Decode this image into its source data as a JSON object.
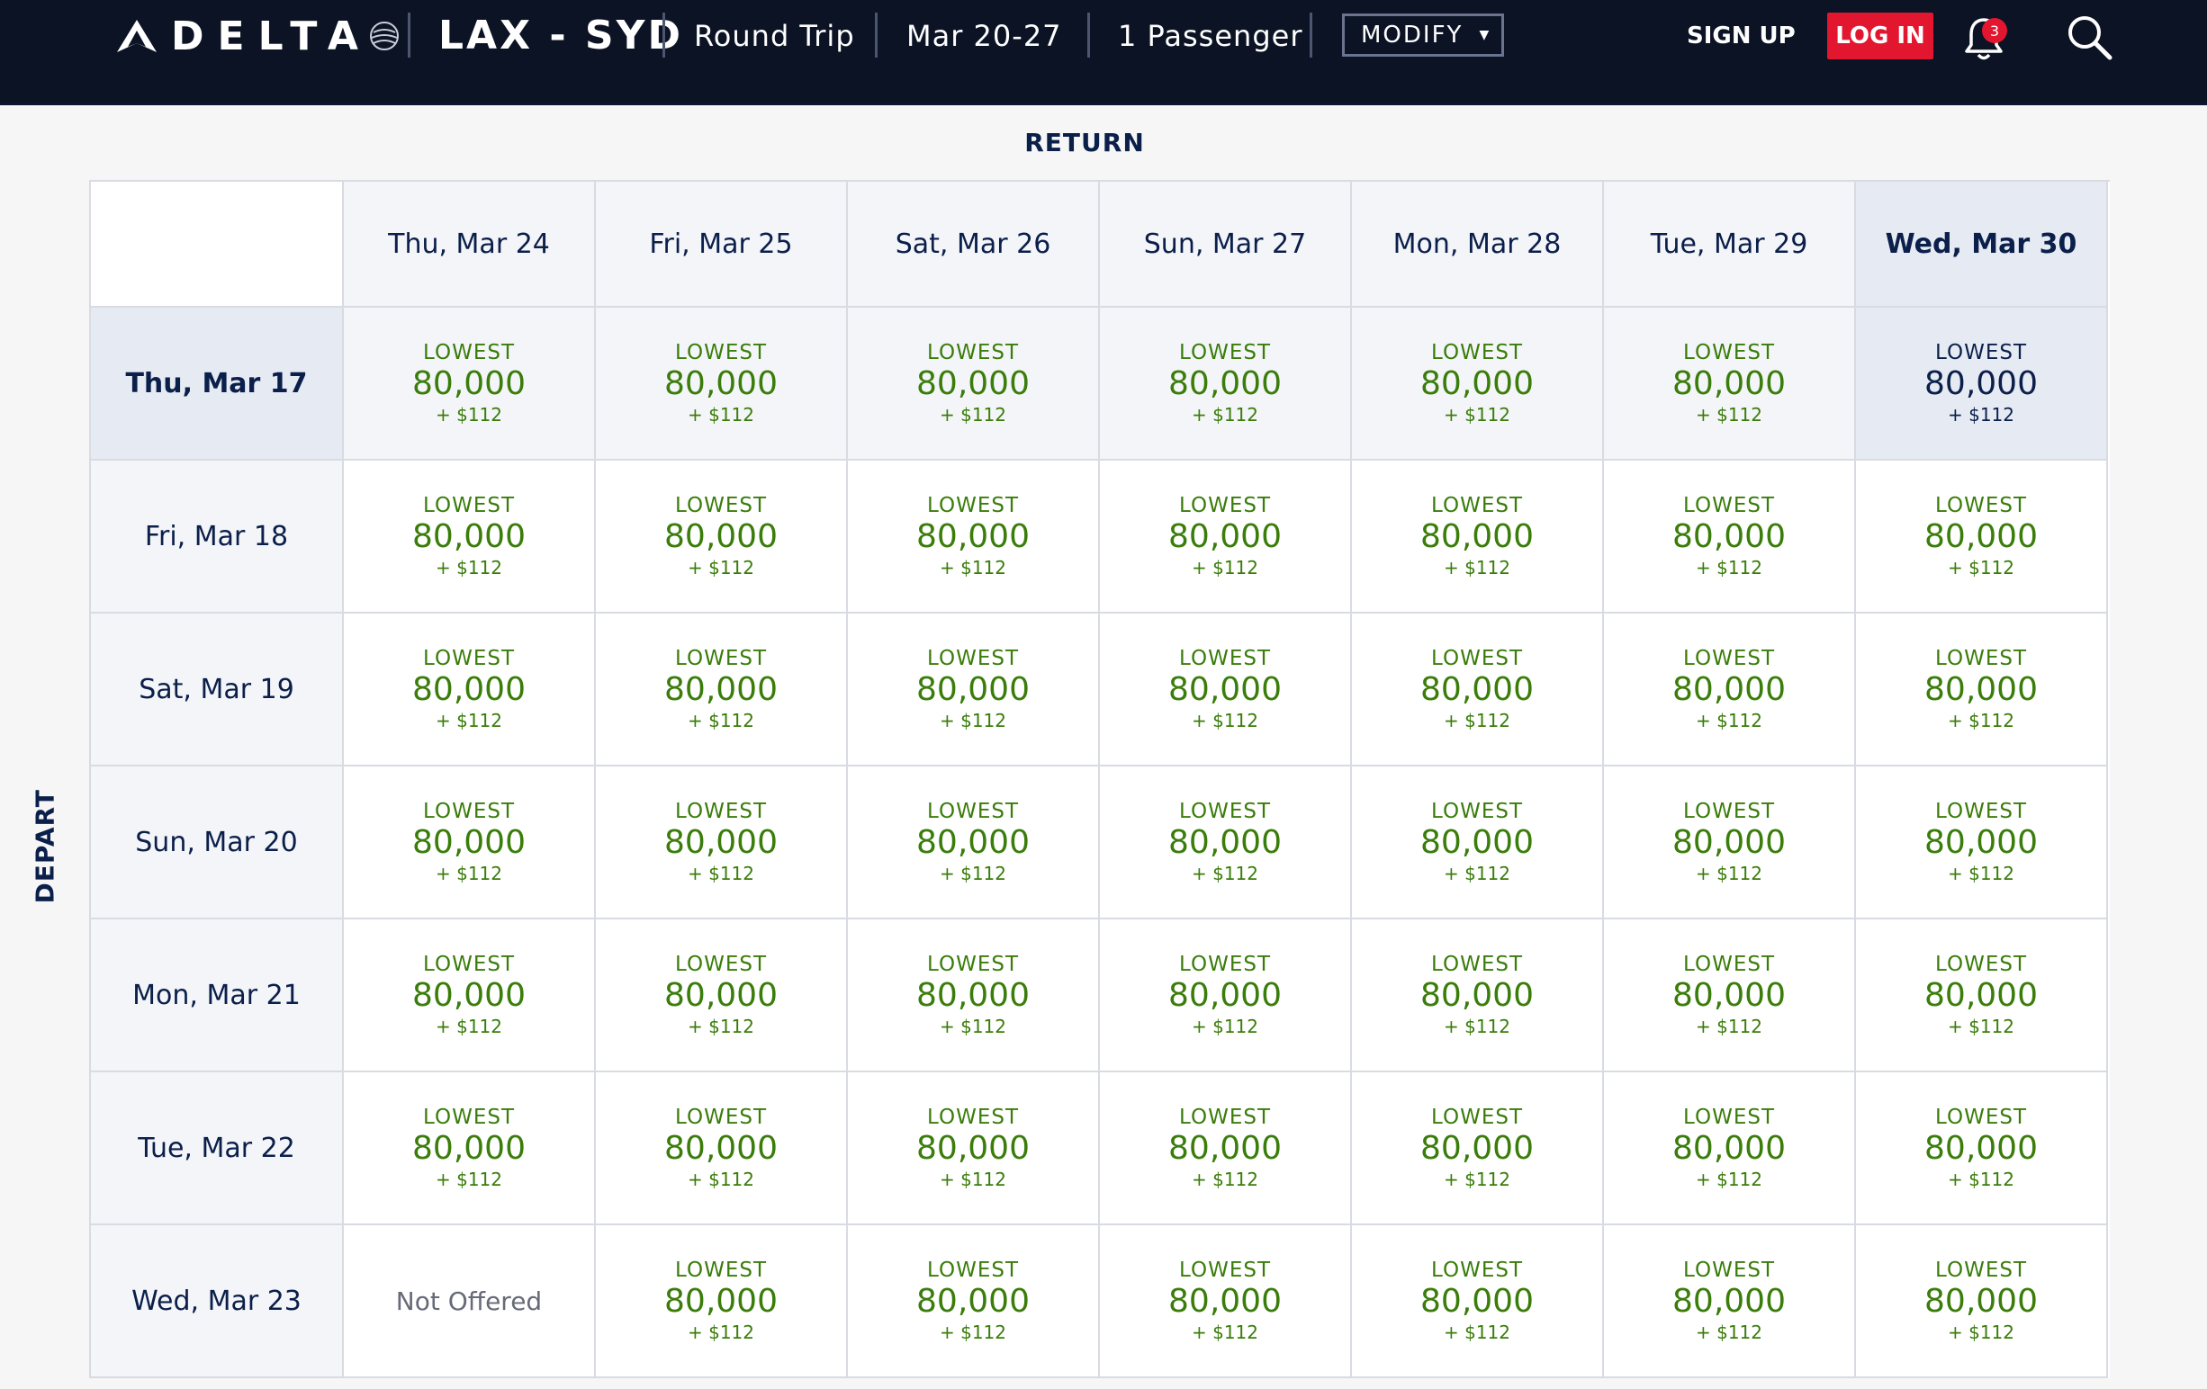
{
  "header": {
    "brand": "DELTA",
    "route": "LAX - SYD",
    "trip_type": "Round Trip",
    "dates": "Mar 20-27",
    "passengers": "1 Passenger",
    "modify_label": "MODIFY",
    "sign_up_label": "SIGN UP",
    "log_in_label": "LOG IN",
    "notification_count": "3"
  },
  "labels": {
    "return": "RETURN",
    "depart": "DEPART"
  },
  "return_dates": [
    "Thu, Mar 24",
    "Fri, Mar 25",
    "Sat, Mar 26",
    "Sun, Mar 27",
    "Mon, Mar 28",
    "Tue, Mar 29",
    "Wed, Mar 30"
  ],
  "selected_return_index": 6,
  "selected_depart_index": 0,
  "rows": [
    {
      "depart": "Thu, Mar 17",
      "fares": [
        {
          "label": "LOWEST",
          "miles": "80,000",
          "tax": "+ $112"
        },
        {
          "label": "LOWEST",
          "miles": "80,000",
          "tax": "+ $112"
        },
        {
          "label": "LOWEST",
          "miles": "80,000",
          "tax": "+ $112"
        },
        {
          "label": "LOWEST",
          "miles": "80,000",
          "tax": "+ $112"
        },
        {
          "label": "LOWEST",
          "miles": "80,000",
          "tax": "+ $112"
        },
        {
          "label": "LOWEST",
          "miles": "80,000",
          "tax": "+ $112"
        },
        {
          "label": "LOWEST",
          "miles": "80,000",
          "tax": "+ $112"
        }
      ]
    },
    {
      "depart": "Fri, Mar 18",
      "fares": [
        {
          "label": "LOWEST",
          "miles": "80,000",
          "tax": "+ $112"
        },
        {
          "label": "LOWEST",
          "miles": "80,000",
          "tax": "+ $112"
        },
        {
          "label": "LOWEST",
          "miles": "80,000",
          "tax": "+ $112"
        },
        {
          "label": "LOWEST",
          "miles": "80,000",
          "tax": "+ $112"
        },
        {
          "label": "LOWEST",
          "miles": "80,000",
          "tax": "+ $112"
        },
        {
          "label": "LOWEST",
          "miles": "80,000",
          "tax": "+ $112"
        },
        {
          "label": "LOWEST",
          "miles": "80,000",
          "tax": "+ $112"
        }
      ]
    },
    {
      "depart": "Sat, Mar 19",
      "fares": [
        {
          "label": "LOWEST",
          "miles": "80,000",
          "tax": "+ $112"
        },
        {
          "label": "LOWEST",
          "miles": "80,000",
          "tax": "+ $112"
        },
        {
          "label": "LOWEST",
          "miles": "80,000",
          "tax": "+ $112"
        },
        {
          "label": "LOWEST",
          "miles": "80,000",
          "tax": "+ $112"
        },
        {
          "label": "LOWEST",
          "miles": "80,000",
          "tax": "+ $112"
        },
        {
          "label": "LOWEST",
          "miles": "80,000",
          "tax": "+ $112"
        },
        {
          "label": "LOWEST",
          "miles": "80,000",
          "tax": "+ $112"
        }
      ]
    },
    {
      "depart": "Sun, Mar 20",
      "fares": [
        {
          "label": "LOWEST",
          "miles": "80,000",
          "tax": "+ $112"
        },
        {
          "label": "LOWEST",
          "miles": "80,000",
          "tax": "+ $112"
        },
        {
          "label": "LOWEST",
          "miles": "80,000",
          "tax": "+ $112"
        },
        {
          "label": "LOWEST",
          "miles": "80,000",
          "tax": "+ $112"
        },
        {
          "label": "LOWEST",
          "miles": "80,000",
          "tax": "+ $112"
        },
        {
          "label": "LOWEST",
          "miles": "80,000",
          "tax": "+ $112"
        },
        {
          "label": "LOWEST",
          "miles": "80,000",
          "tax": "+ $112"
        }
      ]
    },
    {
      "depart": "Mon, Mar 21",
      "fares": [
        {
          "label": "LOWEST",
          "miles": "80,000",
          "tax": "+ $112"
        },
        {
          "label": "LOWEST",
          "miles": "80,000",
          "tax": "+ $112"
        },
        {
          "label": "LOWEST",
          "miles": "80,000",
          "tax": "+ $112"
        },
        {
          "label": "LOWEST",
          "miles": "80,000",
          "tax": "+ $112"
        },
        {
          "label": "LOWEST",
          "miles": "80,000",
          "tax": "+ $112"
        },
        {
          "label": "LOWEST",
          "miles": "80,000",
          "tax": "+ $112"
        },
        {
          "label": "LOWEST",
          "miles": "80,000",
          "tax": "+ $112"
        }
      ]
    },
    {
      "depart": "Tue, Mar 22",
      "fares": [
        {
          "label": "LOWEST",
          "miles": "80,000",
          "tax": "+ $112"
        },
        {
          "label": "LOWEST",
          "miles": "80,000",
          "tax": "+ $112"
        },
        {
          "label": "LOWEST",
          "miles": "80,000",
          "tax": "+ $112"
        },
        {
          "label": "LOWEST",
          "miles": "80,000",
          "tax": "+ $112"
        },
        {
          "label": "LOWEST",
          "miles": "80,000",
          "tax": "+ $112"
        },
        {
          "label": "LOWEST",
          "miles": "80,000",
          "tax": "+ $112"
        },
        {
          "label": "LOWEST",
          "miles": "80,000",
          "tax": "+ $112"
        }
      ]
    },
    {
      "depart": "Wed, Mar 23",
      "fares": [
        {
          "not_offered": "Not Offered"
        },
        {
          "label": "LOWEST",
          "miles": "80,000",
          "tax": "+ $112"
        },
        {
          "label": "LOWEST",
          "miles": "80,000",
          "tax": "+ $112"
        },
        {
          "label": "LOWEST",
          "miles": "80,000",
          "tax": "+ $112"
        },
        {
          "label": "LOWEST",
          "miles": "80,000",
          "tax": "+ $112"
        },
        {
          "label": "LOWEST",
          "miles": "80,000",
          "tax": "+ $112"
        },
        {
          "label": "LOWEST",
          "miles": "80,000",
          "tax": "+ $112"
        }
      ]
    }
  ],
  "colors": {
    "header_bg": "#0b1325",
    "login_red": "#e2162f",
    "fare_green": "#3a7d0a",
    "navy": "#0b1f4b",
    "selected_bg": "#e6eaf3"
  },
  "icons": [
    "delta-widget-icon",
    "skyteam-globe-icon",
    "caret-down-icon",
    "bell-icon",
    "search-icon"
  ]
}
